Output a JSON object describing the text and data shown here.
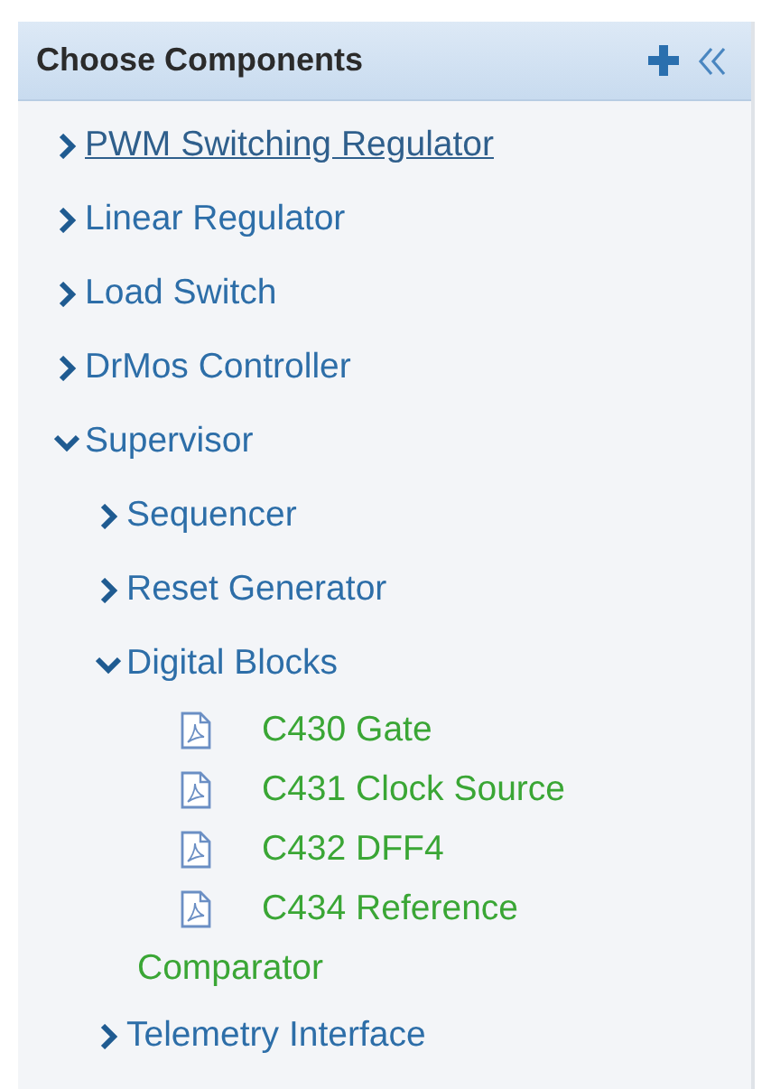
{
  "panel": {
    "title": "Choose Components",
    "tree": [
      {
        "kind": "folder",
        "label": "PWM Switching Regulator",
        "expanded": false,
        "selected": true
      },
      {
        "kind": "folder",
        "label": "Linear Regulator",
        "expanded": false,
        "selected": false
      },
      {
        "kind": "folder",
        "label": "Load Switch",
        "expanded": false,
        "selected": false
      },
      {
        "kind": "folder",
        "label": "DrMos Controller",
        "expanded": false,
        "selected": false
      },
      {
        "kind": "folder",
        "label": "Supervisor",
        "expanded": true,
        "selected": false,
        "children": [
          {
            "kind": "folder",
            "label": "Sequencer",
            "expanded": false,
            "selected": false
          },
          {
            "kind": "folder",
            "label": "Reset Generator",
            "expanded": false,
            "selected": false
          },
          {
            "kind": "folder",
            "label": "Digital Blocks",
            "expanded": true,
            "selected": false,
            "children": [
              {
                "kind": "document",
                "label": "C430 Gate",
                "selected": false
              },
              {
                "kind": "document",
                "label": "C431 Clock Source",
                "selected": false
              },
              {
                "kind": "document",
                "label": "C432 DFF4",
                "selected": false
              },
              {
                "kind": "document",
                "label": "C434 Reference Comparator",
                "selected": false
              }
            ]
          },
          {
            "kind": "folder",
            "label": "Telemetry Interface",
            "expanded": false,
            "selected": false
          }
        ]
      }
    ]
  }
}
